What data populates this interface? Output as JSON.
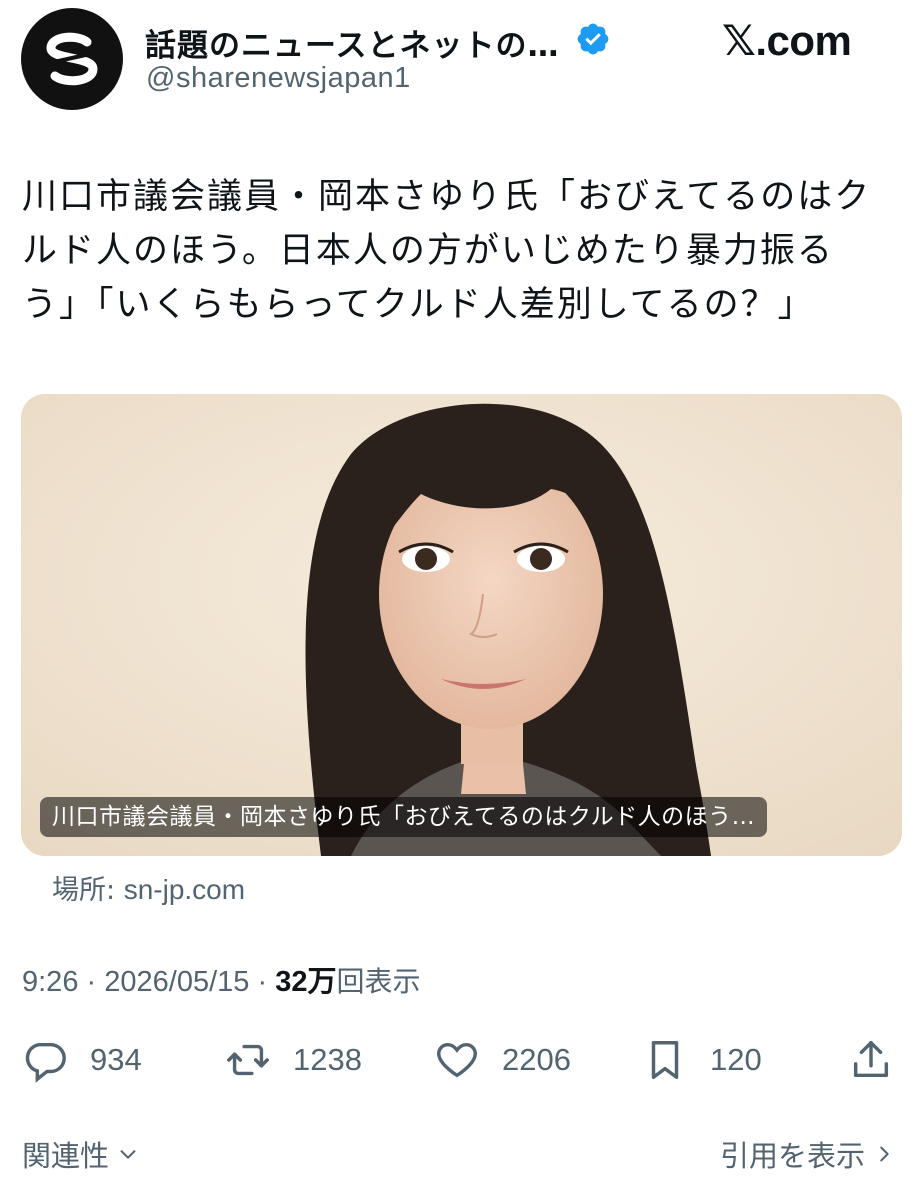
{
  "author": {
    "display_name": "話題のニュースとネットの…",
    "handle": "@sharenewsjapan1",
    "verified": true,
    "avatar_icon": "sharenews-s-logo-icon"
  },
  "brand": {
    "x_glyph": "𝕏",
    "domain_suffix": ".com"
  },
  "tweet": {
    "text_lines": [
      "川口市議会議員・岡本さゆり氏「おびえてるのはク",
      "ルド人のほう。日本人の方がいじめたり暴力振る",
      "う」「いくらもらってクルド人差別してるの？」"
    ]
  },
  "card": {
    "caption": "川口市議会議員・岡本さゆり氏「おびえてるのはクルド人のほう…",
    "source_label": "場所:",
    "source_domain": "sn-jp.com"
  },
  "meta": {
    "time": "9:26",
    "separator": "·",
    "date": "2026/05/15",
    "views_count": "32万",
    "views_label": "回表示"
  },
  "actions": {
    "replies": "934",
    "reposts": "1238",
    "likes": "2206",
    "bookmarks": "120"
  },
  "footer": {
    "related_label": "関連性",
    "quotes_label": "引用を表示"
  },
  "colors": {
    "text_primary": "#0f1419",
    "text_secondary": "#536471",
    "verified_blue": "#1d9bf0"
  }
}
